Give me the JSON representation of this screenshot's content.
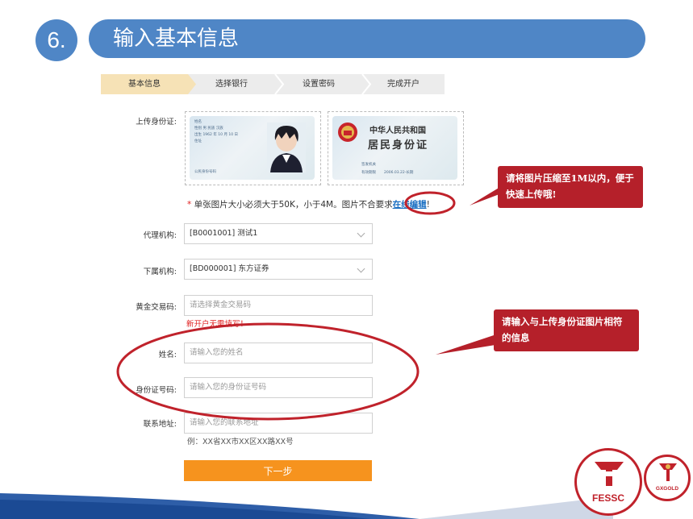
{
  "header": {
    "step_number": "6.",
    "title": "输入基本信息"
  },
  "steps": [
    "基本信息",
    "选择银行",
    "设置密码",
    "完成开户"
  ],
  "form": {
    "upload_label": "上传身份证:",
    "upload_note_star": "*",
    "upload_note": "单张图片大小必须大于50K，小于4M。图片不合要求",
    "upload_link": "在线编辑",
    "upload_note_end": "!",
    "agency_label": "代理机构:",
    "agency_value": "[B0001001] 测试1",
    "sub_agency_label": "下属机构:",
    "sub_agency_value": "[BD000001] 东方证券",
    "gold_code_label": "黄金交易码:",
    "gold_code_placeholder": "请选择黄金交易码",
    "gold_code_hint": "新开户无需填写！",
    "name_label": "姓名:",
    "name_placeholder": "请输入您的姓名",
    "id_label": "身份证号码:",
    "id_placeholder": "请输入您的身份证号码",
    "address_label": "联系地址:",
    "address_placeholder": "请输入您的联系地址",
    "address_example": "例：XX省XX市XX区XX路XX号",
    "next_button": "下一步"
  },
  "id_card_back": {
    "line1": "中华人民共和国",
    "line2": "居民身份证",
    "authority_label": "签发机关",
    "validity_label": "有效期限",
    "validity_value": "2006.03.22-长期"
  },
  "id_card_front": {
    "name_label": "姓名",
    "gender_label": "性别",
    "gender_value": "男",
    "ethnicity_label": "民族",
    "ethnicity_value": "汉族",
    "birth_label": "出生",
    "birth_year": "1962",
    "birth_month_label": "年",
    "birth_month": "10",
    "birth_month_unit": "月",
    "birth_day": "10",
    "birth_day_unit": "日",
    "address_label": "住址",
    "id_number_label": "公民身份号码"
  },
  "callouts": {
    "compress_tip": "请将图片压缩至1M以内，便于快速上传哦!",
    "match_tip": "请输入与上传身份证图片相符的信息"
  },
  "logos": {
    "fessc": "FESSC",
    "gxgold": "GXGOLD"
  },
  "colors": {
    "header_blue": "#4f86c6",
    "callout_red": "#b5202a",
    "button_orange": "#f6931e",
    "link_blue": "#1a6fc2",
    "hint_red": "#e02020"
  }
}
